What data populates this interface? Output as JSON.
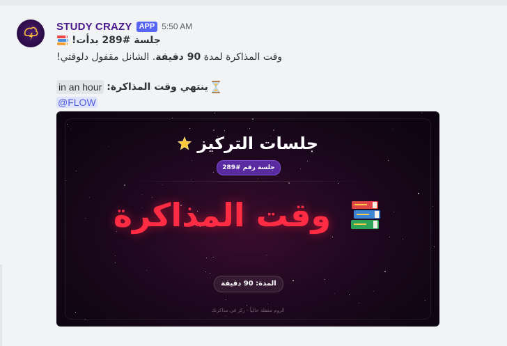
{
  "message": {
    "author": "STUDY CRAZY",
    "badge": "APP",
    "timestamp": "5:50 AM",
    "line1": "جلسة #289 بدأت!",
    "line2_prefix": "وقت المذاكرة لمدة ",
    "line2_bold": "90 دقيقة",
    "line2_suffix": ". الشانل مقفول دلوقتي!",
    "relative_time": "in an hour",
    "line3": "ينتهي وقت المذاكرة:",
    "mention": "@FLOW"
  },
  "card": {
    "title": "جلسات التركيز",
    "session_pill": "جلسة رقم #289",
    "heading": "وقت المذاكرة",
    "duration": "المدة: 90 دقيقة",
    "footer": "الروم مقفلة حالياً - ركز في مذاكرتك"
  },
  "colors": {
    "author": "#4a1a8f",
    "badge": "#5865f2",
    "heading": "#ff2c44",
    "pill": "#5a2aa0"
  }
}
